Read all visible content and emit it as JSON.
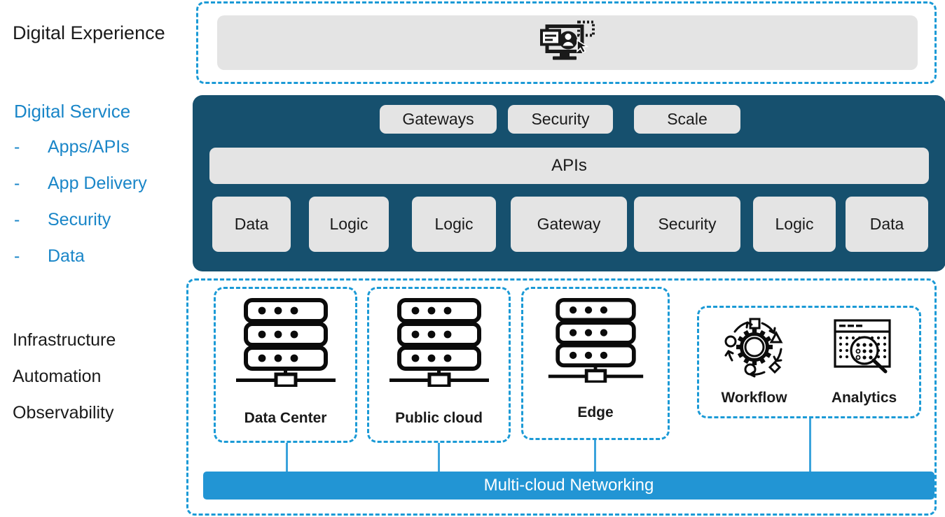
{
  "colors": {
    "accent_blue": "#1a86c8",
    "dashed_blue": "#1b9ad6",
    "panel_teal": "#16506e",
    "chip_gray": "#e4e4e4",
    "bar_blue": "#2295d4",
    "text_dark": "#1a1a1a"
  },
  "left_labels": {
    "digital_experience": "Digital Experience",
    "digital_service": "Digital Service",
    "service_items": [
      {
        "dash": "-",
        "label": "Apps/APIs"
      },
      {
        "dash": "-",
        "label": "App Delivery"
      },
      {
        "dash": "-",
        "label": "Security"
      },
      {
        "dash": "-",
        "label": "Data"
      }
    ],
    "infrastructure_lines": [
      "Infrastructure",
      "Automation",
      "Observability"
    ]
  },
  "digital_experience": {
    "icon": "monitor-user-experience-icon"
  },
  "digital_service": {
    "top_chips": [
      {
        "label": "Gateways"
      },
      {
        "label": "Security"
      },
      {
        "label": "Scale"
      }
    ],
    "apis_label": "APIs",
    "service_blocks": [
      {
        "label": "Data"
      },
      {
        "label": "Logic"
      },
      {
        "label": "Logic"
      },
      {
        "label": "Gateway"
      },
      {
        "label": "Security"
      },
      {
        "label": "Logic"
      },
      {
        "label": "Data"
      }
    ]
  },
  "infrastructure": {
    "nodes": [
      {
        "label": "Data Center",
        "icon": "server-rack-icon"
      },
      {
        "label": "Public cloud",
        "icon": "server-rack-icon"
      },
      {
        "label": "Edge",
        "icon": "server-rack-icon"
      }
    ],
    "tools": [
      {
        "label": "Workflow",
        "icon": "gear-workflow-icon"
      },
      {
        "label": "Analytics",
        "icon": "analytics-magnifier-icon"
      }
    ],
    "networking_bar": "Multi-cloud Networking"
  }
}
